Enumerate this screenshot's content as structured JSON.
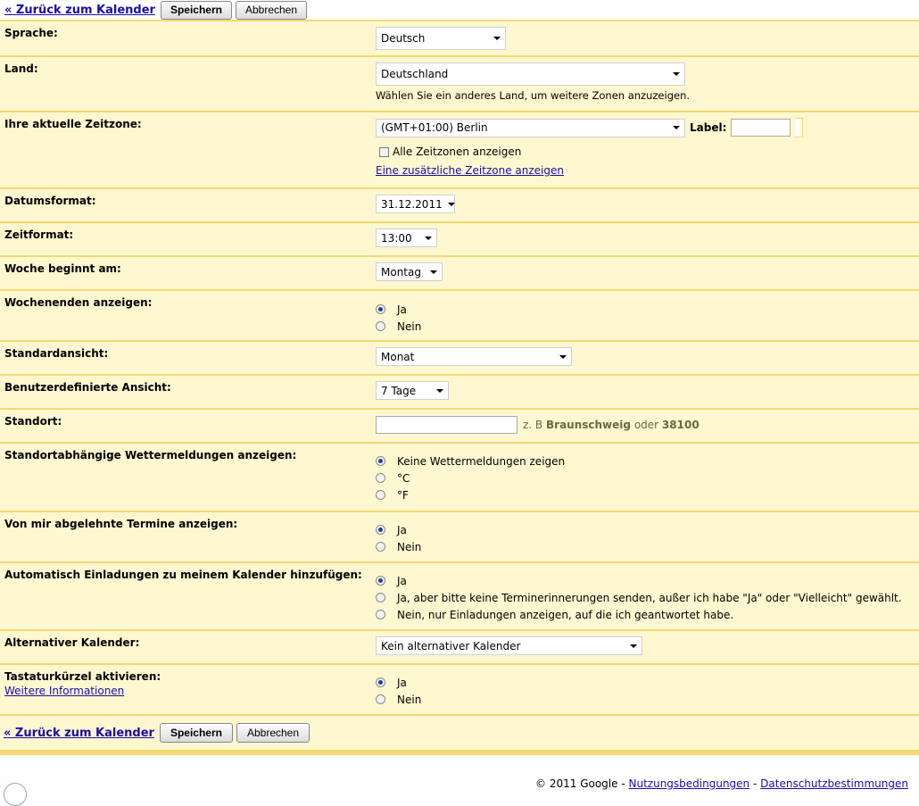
{
  "nav": {
    "back_label": "« Zurück zum Kalender",
    "save_label": "Speichern",
    "cancel_label": "Abbrechen"
  },
  "language": {
    "label": "Sprache:",
    "value": "Deutsch"
  },
  "country": {
    "label": "Land:",
    "value": "Deutschland",
    "hint": "Wählen Sie ein anderes Land, um weitere Zonen anzuzeigen."
  },
  "timezone": {
    "label": "Ihre aktuelle Zeitzone:",
    "value": "(GMT+01:00) Berlin",
    "label_field_label": "Label:",
    "show_all_label": "Alle Zeitzonen anzeigen",
    "additional_link": "Eine zusätzliche Zeitzone anzeigen"
  },
  "date_format": {
    "label": "Datumsformat:",
    "value": "31.12.2011"
  },
  "time_format": {
    "label": "Zeitformat:",
    "value": "13:00"
  },
  "week_start": {
    "label": "Woche beginnt am:",
    "value": "Montag"
  },
  "weekends": {
    "label": "Wochenenden anzeigen:",
    "options": [
      "Ja",
      "Nein"
    ],
    "selected": 0
  },
  "default_view": {
    "label": "Standardansicht:",
    "value": "Monat"
  },
  "custom_view": {
    "label": "Benutzerdefinierte Ansicht:",
    "value": "7 Tage"
  },
  "location": {
    "label": "Standort:",
    "example_prefix": "z. B",
    "example_city": "Braunschweig",
    "example_or": "oder",
    "example_zip": "38100"
  },
  "weather": {
    "label": "Standortabhängige Wettermeldungen anzeigen:",
    "options": [
      "Keine Wettermeldungen zeigen",
      "°C",
      "°F"
    ],
    "selected": 0
  },
  "declined": {
    "label": "Von mir abgelehnte Termine anzeigen:",
    "options": [
      "Ja",
      "Nein"
    ],
    "selected": 0
  },
  "invitations": {
    "label": "Automatisch Einladungen zu meinem Kalender hinzufügen:",
    "options": [
      "Ja",
      "Ja, aber bitte keine Terminerinnerungen senden, außer ich habe \"Ja\" oder \"Vielleicht\" gewählt.",
      "Nein, nur Einladungen anzeigen, auf die ich geantwortet habe."
    ],
    "selected": 0
  },
  "alt_calendar": {
    "label": "Alternativer Kalender:",
    "value": "Kein alternativer Kalender"
  },
  "shortcuts": {
    "label": "Tastaturkürzel aktivieren:",
    "more_info": "Weitere Informationen",
    "options": [
      "Ja",
      "Nein"
    ],
    "selected": 0
  },
  "footer": {
    "copyright": "© 2011 Google -",
    "terms": "Nutzungsbedingungen",
    "separator": "-",
    "privacy": "Datenschutzbestimmungen"
  }
}
